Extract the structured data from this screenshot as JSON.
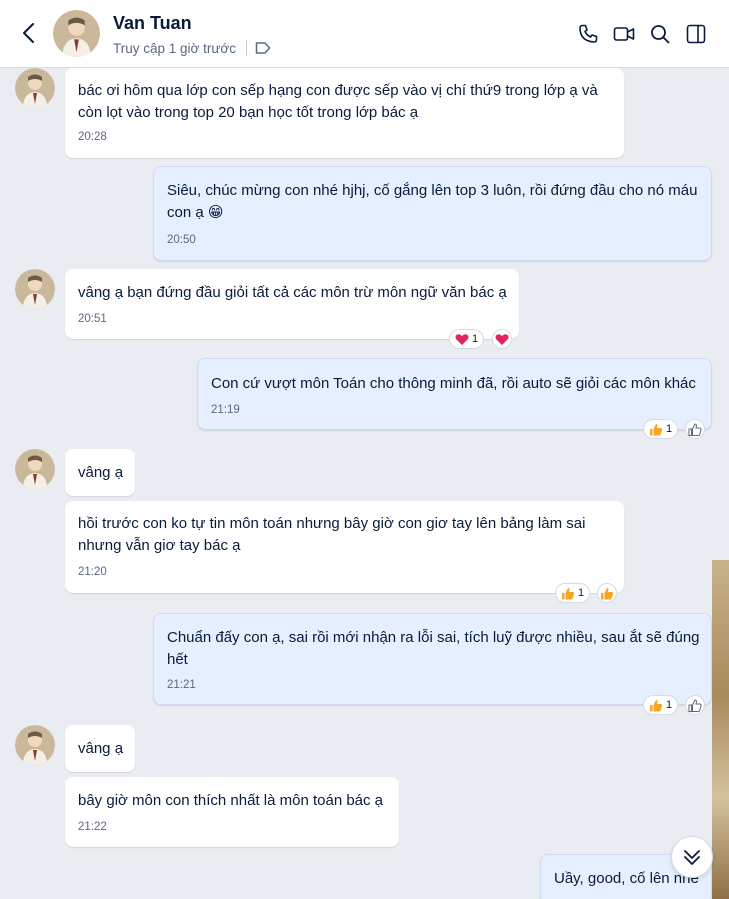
{
  "header": {
    "contact_name": "Van Tuan",
    "status": "Truy cập 1 giờ trước",
    "icons": [
      "back-arrow-icon",
      "tag-icon",
      "phone-icon",
      "video-icon",
      "search-icon",
      "side-panel-icon"
    ]
  },
  "messages": [
    {
      "dir": "in",
      "text": "bác ơi hôm qua lớp con sếp hạng con được sếp vào vị chí thứ9 trong lớp ạ và\ncòn lọt vào trong top 20 bạn học tốt trong lớp bác ạ",
      "time": "20:28"
    },
    {
      "dir": "out",
      "text": "Siêu, chúc mừng con nhé hjhj, cố gắng lên top 3 luôn, rồi đứng đầu cho nó máu\ncon ạ",
      "emoji": "😁",
      "time": "20:50"
    },
    {
      "dir": "in",
      "text": "vâng ạ bạn đứng đầu giỏi tất cả các môn trừ môn ngữ văn bác ạ",
      "time": "20:51",
      "reaction": {
        "emoji": "❤️",
        "count": "1"
      }
    },
    {
      "dir": "out",
      "text": "Con cứ vượt môn Toán cho thông minh đã, rồi auto sẽ giỏi các môn khác",
      "time": "21:19",
      "reaction": {
        "emoji": "👍",
        "count": "1"
      }
    },
    {
      "dir": "in",
      "text": "vâng ạ"
    },
    {
      "dir": "in",
      "text": "hồi trước con ko tự tin môn toán nhưng bây giờ con giơ tay lên bảng làm sai\nnhưng vẫn giơ tay bác ạ",
      "time": "21:20",
      "reaction": {
        "emoji": "👍",
        "count": "1"
      }
    },
    {
      "dir": "out",
      "text": "Chuẩn đấy con ạ, sai rồi mới nhận ra lỗi sai, tích luỹ được nhiều, sau ắt sẽ đúng\nhết",
      "time": "21:21",
      "reaction": {
        "emoji": "👍",
        "count": "1"
      }
    },
    {
      "dir": "in",
      "text": "vâng ạ"
    },
    {
      "dir": "in",
      "text": "bây giờ môn con thích nhất là môn toán bác ạ",
      "time": "21:22"
    },
    {
      "dir": "out",
      "text": "Uầy, good, cố lên nhé"
    }
  ],
  "colors": {
    "background": "#e9ecf0",
    "incoming_bubble": "#ffffff",
    "outgoing_bubble": "#e5efff",
    "text": "#081b3a",
    "meta_text": "#5a6981",
    "heart": "#e0245e",
    "like": "#f5a623"
  }
}
